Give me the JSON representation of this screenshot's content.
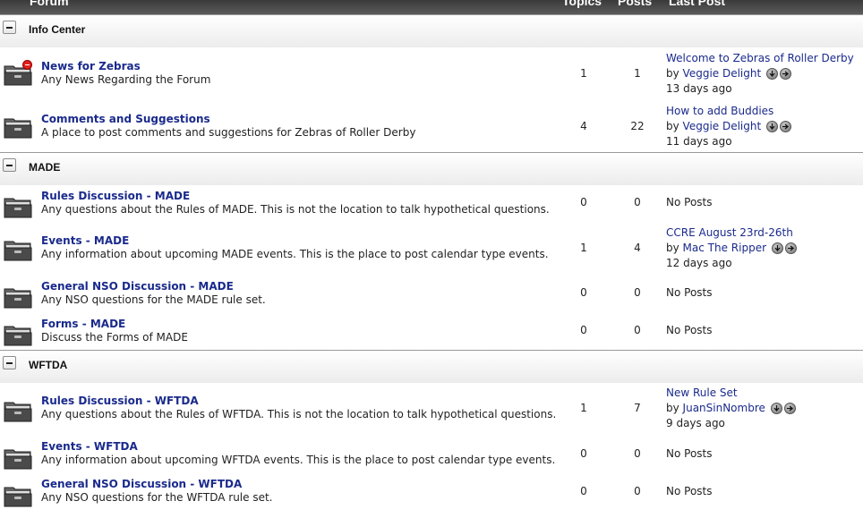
{
  "header": {
    "col_forum": "Forum",
    "col_topics": "Topics",
    "col_posts": "Posts",
    "col_last_post": "Last Post"
  },
  "categories": [
    {
      "title": "Info Center",
      "forums": [
        {
          "name": "News for Zebras",
          "desc": "Any News Regarding the Forum",
          "topics": "1",
          "posts": "1",
          "last_post": {
            "title": "Welcome to Zebras of Roller Derby",
            "by": "by",
            "user": "Veggie Delight",
            "ago": "13 days ago"
          },
          "new_badge": true
        },
        {
          "name": "Comments and Suggestions",
          "desc": "A place to post comments and suggestions for Zebras of Roller Derby",
          "topics": "4",
          "posts": "22",
          "last_post": {
            "title": "How to add Buddies",
            "by": "by",
            "user": "Veggie Delight",
            "ago": "11 days ago"
          }
        }
      ]
    },
    {
      "title": "MADE",
      "forums": [
        {
          "name": "Rules Discussion - MADE",
          "desc": "Any questions about the Rules of MADE. This is not the location to talk hypothetical questions.",
          "topics": "0",
          "posts": "0",
          "no_posts": "No Posts"
        },
        {
          "name": "Events - MADE",
          "desc": "Any information about upcoming MADE events. This is the place to post calendar type events.",
          "topics": "1",
          "posts": "4",
          "last_post": {
            "title": "CCRE August 23rd-26th",
            "by": "by",
            "user": "Mac The Ripper",
            "ago": "12 days ago"
          }
        },
        {
          "name": "General NSO Discussion - MADE",
          "desc": "Any NSO questions for the MADE rule set.",
          "topics": "0",
          "posts": "0",
          "no_posts": "No Posts"
        },
        {
          "name": "Forms - MADE",
          "desc": "Discuss the Forms of MADE",
          "topics": "0",
          "posts": "0",
          "no_posts": "No Posts"
        }
      ]
    },
    {
      "title": "WFTDA",
      "forums": [
        {
          "name": "Rules Discussion - WFTDA",
          "desc": "Any questions about the Rules of WFTDA. This is not the location to talk hypothetical questions.",
          "topics": "1",
          "posts": "7",
          "last_post": {
            "title": "New Rule Set",
            "by": "by",
            "user": "JuanSinNombre",
            "ago": "9 days ago"
          }
        },
        {
          "name": "Events - WFTDA",
          "desc": "Any information about upcoming WFTDA events. This is the place to post calendar type events.",
          "topics": "0",
          "posts": "0",
          "no_posts": "No Posts"
        },
        {
          "name": "General NSO Discussion - WFTDA",
          "desc": "Any NSO questions for the WFTDA rule set.",
          "topics": "0",
          "posts": "0",
          "no_posts": "No Posts"
        }
      ]
    }
  ],
  "icons": {
    "folder": "folder-icon",
    "collapse": "collapse-icon",
    "goto_post": "go-to-post-icon",
    "goto_new": "go-to-newest-icon",
    "new_badge": "no-entry-badge-icon"
  },
  "colors": {
    "link": "#1a2a8c",
    "header_bg": "#4a4a4a",
    "new_badge": "#e02020"
  }
}
